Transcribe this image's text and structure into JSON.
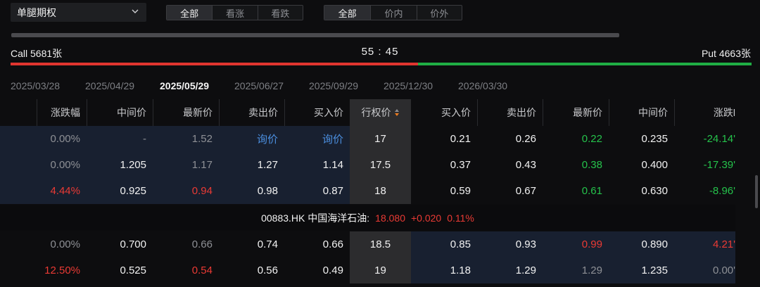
{
  "selector": {
    "label": "单腿期权"
  },
  "filter1": {
    "options": [
      "全部",
      "看涨",
      "看跌"
    ]
  },
  "filter2": {
    "options": [
      "全部",
      "价内",
      "价外"
    ]
  },
  "ratio": {
    "call_label": "Call 5681张",
    "ratio": "55 : 45",
    "put_label": "Put 4663张",
    "call_fraction": 0.55
  },
  "expiries": [
    "2025/03/28",
    "2025/04/29",
    "2025/05/29",
    "2025/06/27",
    "2025/09/29",
    "2025/12/30",
    "2026/03/30"
  ],
  "active_expiry": "2025/05/29",
  "headers": {
    "call_change": "涨跌幅",
    "call_mid": "中间价",
    "call_last": "最新价",
    "call_ask": "卖出价",
    "call_bid": "买入价",
    "strike": "行权价",
    "put_bid": "买入价",
    "put_ask": "卖出价",
    "put_last": "最新价",
    "put_mid": "中间价",
    "put_change": "涨跌l"
  },
  "rows": [
    {
      "call_change": "0.00%",
      "call_mid": "-",
      "call_last": "1.52",
      "call_ask": "询价",
      "call_bid": "询价",
      "strike": "17",
      "put_bid": "0.21",
      "put_ask": "0.26",
      "put_last": "0.22",
      "put_mid": "0.235",
      "put_change": "-24.14'"
    },
    {
      "call_change": "0.00%",
      "call_mid": "1.205",
      "call_last": "1.17",
      "call_ask": "1.27",
      "call_bid": "1.14",
      "strike": "17.5",
      "put_bid": "0.37",
      "put_ask": "0.43",
      "put_last": "0.38",
      "put_mid": "0.400",
      "put_change": "-17.39'"
    },
    {
      "call_change": "4.44%",
      "call_mid": "0.925",
      "call_last": "0.94",
      "call_ask": "0.98",
      "call_bid": "0.87",
      "strike": "18",
      "put_bid": "0.59",
      "put_ask": "0.67",
      "put_last": "0.61",
      "put_mid": "0.630",
      "put_change": "-8.96'"
    }
  ],
  "spot": {
    "code": "00883.HK 中国海洋石油:",
    "price": "18.080",
    "change": "+0.020",
    "pct": "0.11%"
  },
  "rows2": [
    {
      "call_change": "0.00%",
      "call_mid": "0.700",
      "call_last": "0.66",
      "call_ask": "0.74",
      "call_bid": "0.66",
      "strike": "18.5",
      "put_bid": "0.85",
      "put_ask": "0.93",
      "put_last": "0.99",
      "put_mid": "0.890",
      "put_change": "4.21'"
    },
    {
      "call_change": "12.50%",
      "call_mid": "0.525",
      "call_last": "0.54",
      "call_ask": "0.56",
      "call_bid": "0.49",
      "strike": "19",
      "put_bid": "1.18",
      "put_ask": "1.29",
      "put_last": "1.29",
      "put_mid": "1.235",
      "put_change": "0.00'"
    }
  ],
  "colors": {
    "up": "#ea3a34",
    "down": "#25c24b",
    "accent": "#4b8fe0",
    "itm_bg": "#182030"
  }
}
